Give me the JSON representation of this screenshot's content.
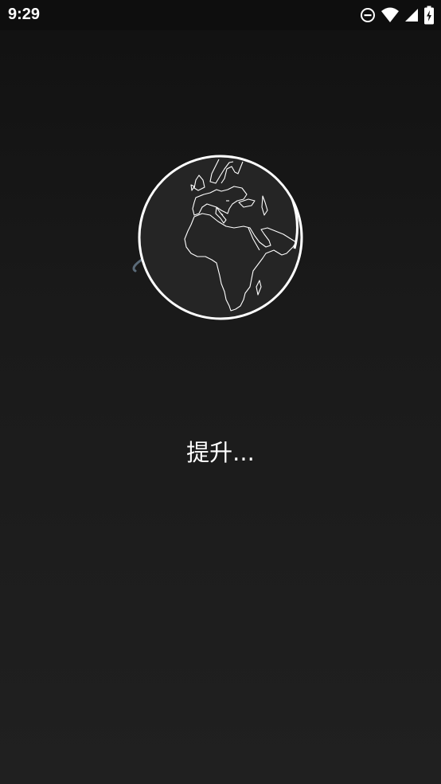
{
  "status_bar": {
    "time": "9:29",
    "icons": [
      "do-not-disturb-icon",
      "wifi-icon",
      "cellular-signal-icon",
      "battery-charging-icon"
    ]
  },
  "loader": {
    "icon": "globe-icon",
    "spinner_color": "#5a6a78",
    "ring_color": "#ffffff"
  },
  "status_text": "提升..."
}
